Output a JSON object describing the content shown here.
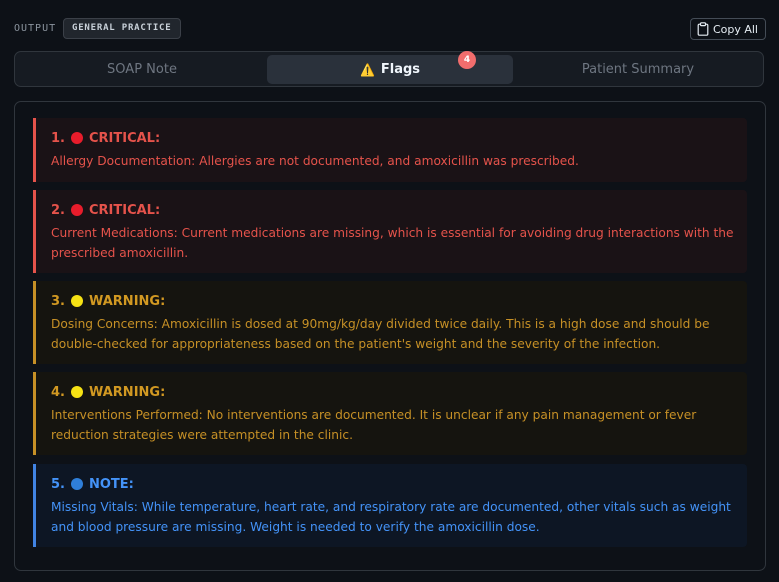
{
  "header": {
    "output_label": "OUTPUT",
    "context_badge": "GENERAL PRACTICE",
    "copy_label": "Copy All"
  },
  "tabs": [
    {
      "label": "SOAP Note",
      "active": false
    },
    {
      "label": "Flags",
      "active": true,
      "icon": "warning-icon",
      "count": "4"
    },
    {
      "label": "Patient Summary",
      "active": false
    }
  ],
  "flags": [
    {
      "number": "1.",
      "severity": "CRITICAL:",
      "level": "critical",
      "text": "Allergy Documentation: Allergies are not documented, and amoxicillin was prescribed."
    },
    {
      "number": "2.",
      "severity": "CRITICAL:",
      "level": "critical",
      "text": "Current Medications: Current medications are missing, which is essential for avoiding drug interactions with the prescribed amoxicillin."
    },
    {
      "number": "3.",
      "severity": "WARNING:",
      "level": "warning",
      "text": "Dosing Concerns: Amoxicillin is dosed at 90mg/kg/day divided twice daily. This is a high dose and should be double-checked for appropriateness based on the patient's weight and the severity of the infection."
    },
    {
      "number": "4.",
      "severity": "WARNING:",
      "level": "warning",
      "text": "Interventions Performed: No interventions are documented. It is unclear if any pain management or fever reduction strategies were attempted in the clinic."
    },
    {
      "number": "5.",
      "severity": "NOTE:",
      "level": "note",
      "text": "Missing Vitals: While temperature, heart rate, and respiratory rate are documented, other vitals such as weight and blood pressure are missing. Weight is needed to verify the amoxicillin dose."
    }
  ],
  "colors": {
    "critical": "#e5534b",
    "warning": "#d29922",
    "note": "#4493f8",
    "count_badge": "#f26d6d"
  }
}
